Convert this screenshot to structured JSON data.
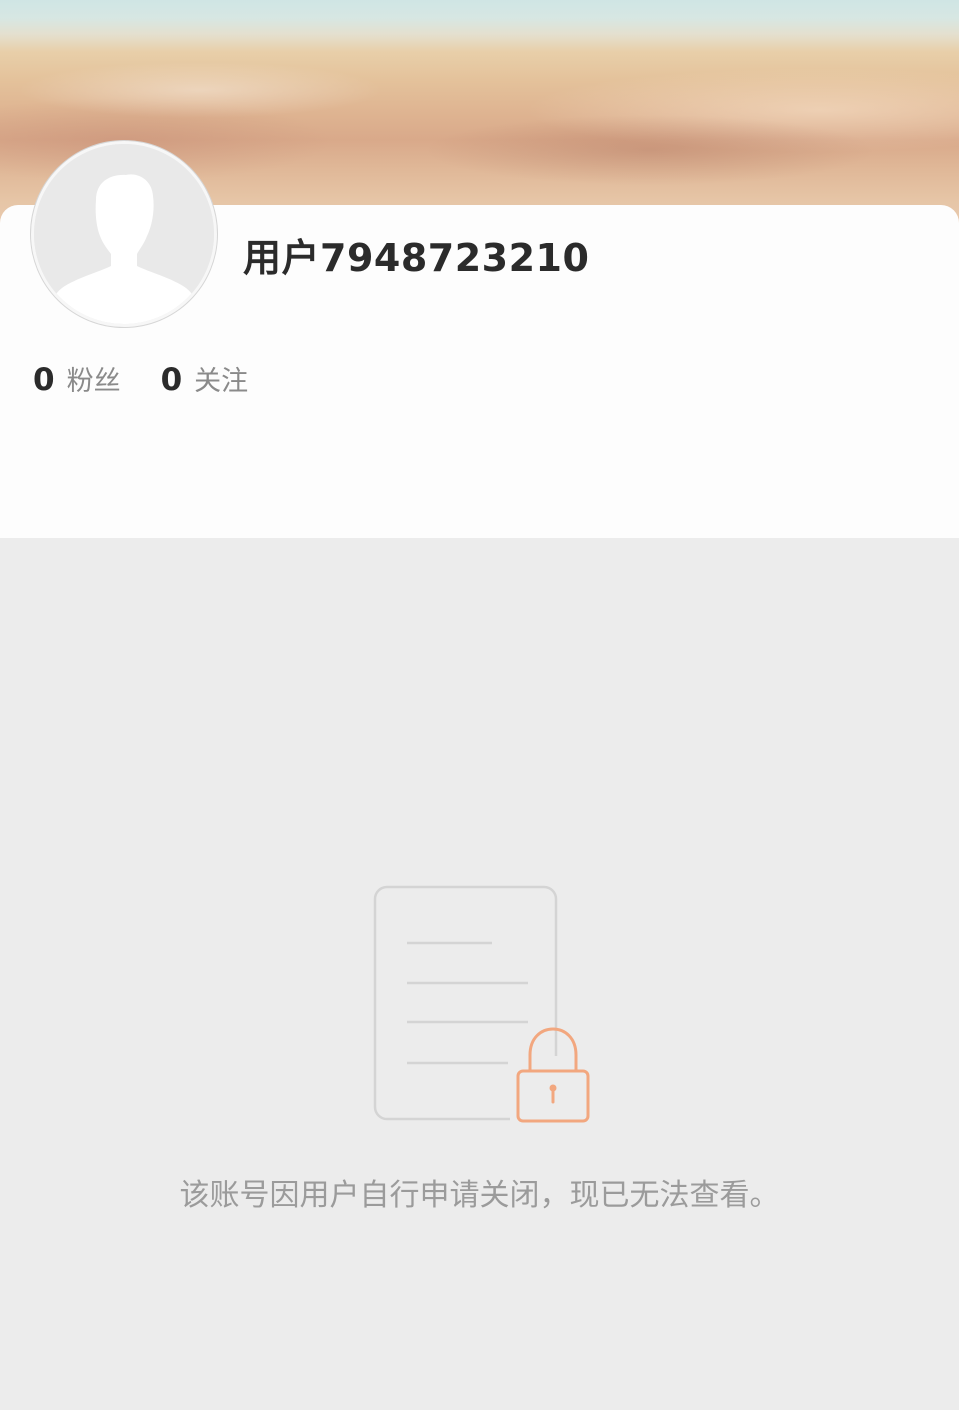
{
  "profile": {
    "username": "用户7948723210",
    "stats": [
      {
        "count": "0",
        "label": "粉丝"
      },
      {
        "count": "0",
        "label": "关注"
      }
    ]
  },
  "cover": {
    "icon": "beach-sand-cover-image"
  },
  "avatar": {
    "icon": "default-avatar-icon"
  },
  "empty_state": {
    "icon": "locked-document-icon",
    "message": "该账号因用户自行申请关闭，现已无法查看。",
    "accent_color": "#f2a77f"
  }
}
